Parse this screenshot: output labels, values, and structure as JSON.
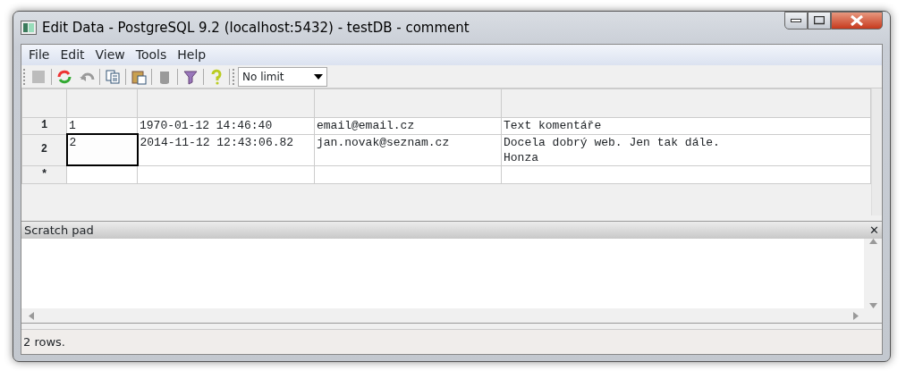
{
  "window": {
    "title": "Edit Data - PostgreSQL 9.2 (localhost:5432) - testDB - comment"
  },
  "menu": [
    "File",
    "Edit",
    "View",
    "Tools",
    "Help"
  ],
  "toolbar": [
    {
      "kind": "save",
      "disabled": true
    },
    {
      "kind": "sep"
    },
    {
      "kind": "refresh",
      "disabled": false
    },
    {
      "kind": "undo",
      "disabled": true
    },
    {
      "kind": "sep"
    },
    {
      "kind": "copy",
      "disabled": false
    },
    {
      "kind": "sep"
    },
    {
      "kind": "paste",
      "disabled": false
    },
    {
      "kind": "sep"
    },
    {
      "kind": "delete",
      "disabled": true
    },
    {
      "kind": "sep"
    },
    {
      "kind": "filter",
      "disabled": false
    },
    {
      "kind": "sep"
    },
    {
      "kind": "help",
      "disabled": false
    }
  ],
  "limit": {
    "value": "No limit"
  },
  "grid": {
    "rows": [
      {
        "header": "1",
        "cells": [
          {
            "text": "1",
            "selected": false
          },
          {
            "text": "1970-01-12 14:46:40",
            "selected": false
          },
          {
            "text": "email@email.cz",
            "selected": false
          },
          {
            "text": "Text komentáře",
            "selected": false
          }
        ]
      },
      {
        "header": "2",
        "cells": [
          {
            "text": "2",
            "selected": true
          },
          {
            "text": "2014-11-12 12:43:06.82",
            "selected": false
          },
          {
            "text": "jan.novak@seznam.cz",
            "selected": false
          },
          {
            "text": "Docela dobrý web. Jen tak dále.\nHonza",
            "selected": false
          }
        ]
      },
      {
        "header": "*",
        "cells": [
          {
            "text": "",
            "selected": false
          },
          {
            "text": "",
            "selected": false
          },
          {
            "text": "",
            "selected": false
          },
          {
            "text": "",
            "selected": false
          }
        ]
      }
    ]
  },
  "scratch_pad": {
    "title": "Scratch pad",
    "close": "✕"
  },
  "status_bar": "2 rows."
}
